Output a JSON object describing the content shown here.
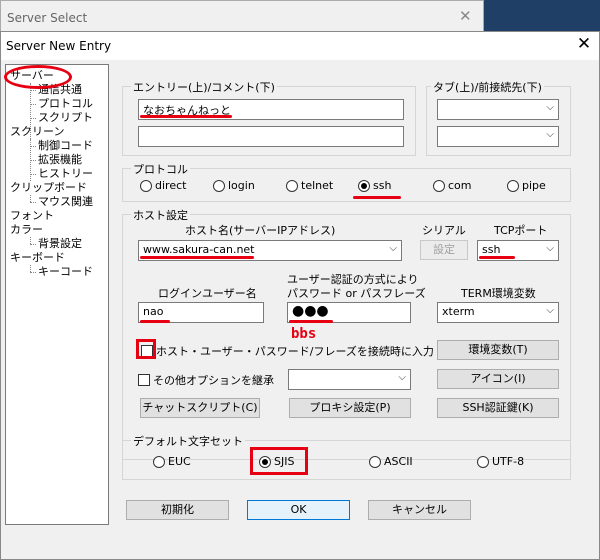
{
  "background_window": {
    "title": "Server Select"
  },
  "dialog": {
    "title": "Server New Entry"
  },
  "tree": {
    "items": [
      "サーバー",
      "通信共通",
      "プロトコル",
      "スクリプト",
      "スクリーン",
      "制御コード",
      "拡張機能",
      "ヒストリー",
      "クリップボード",
      "マウス関連",
      "フォント",
      "カラー",
      "背景設定",
      "キーボード",
      "キーコード"
    ]
  },
  "entry": {
    "label": "エントリー(上)/コメント(下)",
    "name_value": "なおちゃんねっと",
    "comment_value": ""
  },
  "tag": {
    "label": "タブ(上)/前接続先(下)"
  },
  "protocol": {
    "label": "プロトコル",
    "options": [
      "direct",
      "login",
      "telnet",
      "ssh",
      "com",
      "pipe"
    ],
    "selected": "ssh"
  },
  "host": {
    "group_label": "ホスト設定",
    "host_label": "ホスト名(サーバーIPアドレス)",
    "host_value": "www.sakura-can.net",
    "serial_label": "シリアル",
    "settings_button": "設定",
    "tcp_port_label": "TCPポート",
    "tcp_port_value": "ssh",
    "login_user_label": "ログインユーザー名",
    "login_user_value": "nao",
    "auth_label_line1": "ユーザー認証の方式により",
    "auth_label_line2": "パスワード or パスフレーズ",
    "password_value": "●●●",
    "password_annotation": "bbs",
    "term_label": "TERM環境変数",
    "term_value": "xterm",
    "remember_check": "ホスト・ユーザー・パスワード/フレーズを接続時に入力",
    "env_button": "環境変数(T)",
    "other_options_check": "その他オプションを継承",
    "icon_button": "アイコン(I)",
    "chat_button": "チャットスクリプト(C)",
    "proxy_button": "プロキシ設定(P)",
    "ssh_auth_button": "SSH認証鍵(K)"
  },
  "charset": {
    "label": "デフォルト文字セット",
    "options": [
      "EUC",
      "SJIS",
      "ASCII",
      "UTF-8"
    ],
    "selected": "SJIS"
  },
  "footer": {
    "init_button": "初期化",
    "ok_button": "OK",
    "cancel_button": "キャンセル"
  },
  "colors": {
    "annotation_red": "#e60012",
    "focus_blue": "#0078d7"
  }
}
